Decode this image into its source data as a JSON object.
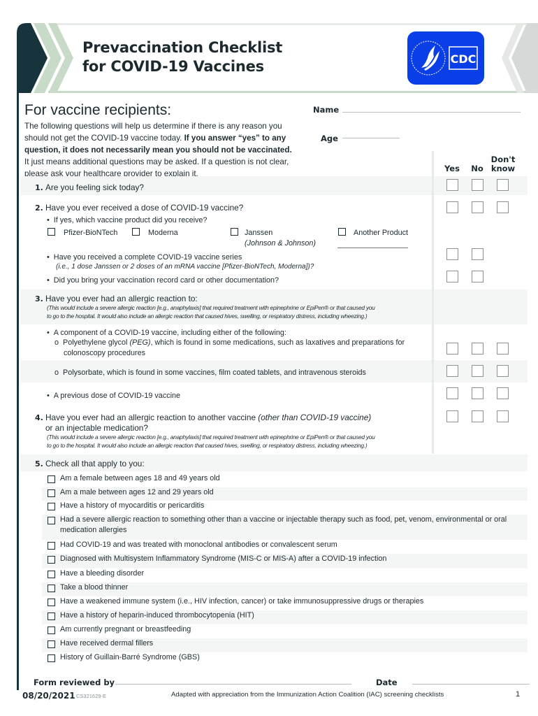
{
  "header": {
    "title_line1": "Prevaccination Checklist",
    "title_line2": "for COVID-19 Vaccines",
    "logo_text": "CDC"
  },
  "intro": {
    "heading": "For vaccine recipients:",
    "text_part1": "The following questions will help us determine if there is any reason you should not get the COVID-19 vaccine today. ",
    "text_bold": "If you answer “yes” to any question, it does not necessarily mean you should not be vaccinated.",
    "text_part2": " It just means additional questions may be asked. If a question is not clear, please ask your healthcare provider to explain it."
  },
  "fields": {
    "name_label": "Name",
    "name_value": "",
    "age_label": "Age",
    "age_value": ""
  },
  "columns": {
    "yes": "Yes",
    "no": "No",
    "dont_know_line1": "Don't",
    "dont_know_line2": "know"
  },
  "questions": {
    "q1": {
      "num": "1.",
      "text": "Are you feeling sick today?"
    },
    "q2": {
      "num": "2.",
      "text": "Have you ever received a dose of COVID-19 vaccine?",
      "sub1": "If yes, which vaccine product did you receive?",
      "products": [
        {
          "label": "Pfizer-BioNTech",
          "sublabel": ""
        },
        {
          "label": "Moderna",
          "sublabel": ""
        },
        {
          "label": "Janssen",
          "sublabel": "(Johnson & Johnson)"
        },
        {
          "label": "Another Product",
          "sublabel": ""
        }
      ],
      "another_product_value": "",
      "sub2": "Have you received a complete COVID-19 vaccine series",
      "sub2_note": "(i.e., 1 dose Janssen or 2 doses of an mRNA vaccine [Pfizer-BioNTech, Moderna])?",
      "sub3": "Did you bring your vaccination record card or other documentation?"
    },
    "q3": {
      "num": "3.",
      "text": "Have you ever had an allergic reaction to:",
      "note_line1": "(This would include a severe allergic reaction [e.g., anaphylaxis] that required treatment with epinephrine or EpiPen® or that caused you",
      "note_line2": "to go to the hospital. It would also include an allergic reaction that caused hives, swelling, or respiratory distress, including wheezing.)",
      "component_intro": "A component of a COVID-19 vaccine, including either of the following:",
      "peg_prefix": "Polyethylene glycol ",
      "peg_italic": "(PEG)",
      "peg_suffix": ", which is found in some medications, such as laxatives and preparations for",
      "peg_line2": "colonoscopy procedures",
      "polysorbate": "Polysorbate, which is found in some vaccines, film coated tablets, and intravenous steroids",
      "previous_dose": "A previous dose of COVID-19 vaccine"
    },
    "q4": {
      "num": "4.",
      "text_prefix": "Have you ever had an allergic reaction to another vaccine ",
      "text_italic": "(other than COVID-19 vaccine)",
      "text_line2": "or an injectable medication?",
      "note_line1": "(This would include a severe allergic reaction [e.g., anaphylaxis] that required treatment with epinephrine or EpiPen® or that caused you",
      "note_line2": "to go to the hospital. It would also include an allergic reaction that caused hives, swelling, or respiratory distress, including wheezing.)"
    },
    "q5": {
      "num": "5.",
      "text": "Check all that apply to you:",
      "items": [
        "Am a female between ages 18 and 49 years old",
        "Am a male between ages 12 and 29 years old",
        "Have a history of myocarditis or pericarditis",
        "Had a severe allergic reaction to something other than a vaccine or injectable therapy such as food, pet, venom, environmental or oral medication allergies",
        "Had COVID-19 and was treated with monoclonal antibodies or convalescent serum",
        "Diagnosed with Multisystem Inflammatory Syndrome (MIS-C or MIS-A) after a COVID-19 infection",
        "Have a bleeding disorder",
        "Take a blood thinner",
        "Have a weakened immune system (i.e., HIV infection, cancer) or take immunosuppressive drugs or therapies",
        "Have a history of heparin-induced thrombocytopenia (HIT)",
        "Am currently pregnant or breastfeeding",
        "Have received dermal fillers",
        "History of Guillain-Barré Syndrome (GBS)"
      ]
    }
  },
  "footer": {
    "reviewed_by_label": "Form reviewed by",
    "reviewed_by_value": "",
    "date_label": "Date",
    "date_value": "",
    "revision_date": "08/20/2021",
    "doc_code": "CS321629-E",
    "credit": "Adapted with appreciation from the Immunization Action Coalition (IAC) screening checklists",
    "page_number": "1"
  },
  "colors": {
    "dark_teal": "#17333b",
    "sage": "#c8dbc9",
    "cdc_blue": "#0a3fe8",
    "stripe": "#f4f5f5"
  }
}
